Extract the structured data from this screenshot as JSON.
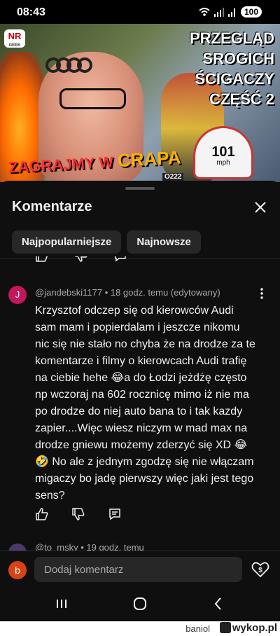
{
  "status_bar": {
    "time": "08:43",
    "battery": "100"
  },
  "video": {
    "logo_top": "NR",
    "logo_bottom": "GEEK",
    "headline": [
      "PRZEGLĄD",
      "SROGICH",
      "ŚCIGACZY",
      "CZĘŚĆ 2"
    ],
    "game_title_a": "ZAGRAJMY W ",
    "game_title_b": "CRAPA",
    "plate": "O222",
    "speed": "101",
    "speed_unit": "mph"
  },
  "comments_panel": {
    "title": "Komentarze",
    "sort_chips": [
      "Najpopularniejsze",
      "Najnowsze"
    ]
  },
  "comment": {
    "avatar_letter": "J",
    "meta": "@jandebski1177 • 18 godz. temu (edytowany)",
    "text": "Krzysztof odczep się od kierowców Audi sam mam i popierdalam i jeszcze nikomu nic się nie stało no chyba że na drodze za te komentarze i filmy o kierowcach Audi trafię na ciebie hehe 😂a do Łodzi jeżdżę często np wczoraj na 602 rocznicę mimo iż nie ma po drodze do niej auto bana to i tak kazdy zapier....Więc wiesz niczym w mad max na drodze gniewu możemy zderzyć się XD 😂 🤣 No ale z jednym zgodzę się nie włączam migaczy bo jadę pierwszy więc jaki jest tego sens?"
  },
  "next_comment": {
    "meta": "@to_msky • 19 godz. temu"
  },
  "input": {
    "avatar_letter": "b",
    "placeholder": "Dodaj komentarz"
  },
  "watermark": {
    "user": "baniol",
    "site": "wykop.pl"
  },
  "colors": {
    "background": "#0f0f0f",
    "chip": "#272727",
    "comment_avatar": "#c2185b",
    "user_avatar": "#d84315"
  }
}
